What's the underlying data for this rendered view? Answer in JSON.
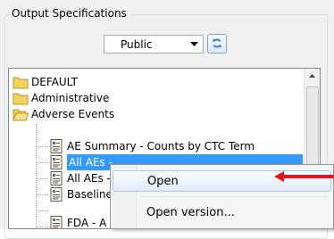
{
  "output_specifications": {
    "title": "Output Specifications",
    "visibility_select": {
      "value": "Public"
    }
  },
  "tree": {
    "items": [
      {
        "label": "DEFAULT",
        "type": "folder"
      },
      {
        "label": "Administrative",
        "type": "folder"
      },
      {
        "label": "Adverse Events",
        "type": "folder-open"
      },
      {
        "label": "AE Summary - Counts by CTC Term",
        "type": "report"
      },
      {
        "label": "All AEs - ",
        "type": "report",
        "selected": true
      },
      {
        "label": "All AEs - ",
        "type": "report"
      },
      {
        "label": "Baseline",
        "type": "report"
      },
      {
        "label": "FDA - A",
        "type": "report"
      }
    ]
  },
  "context_menu": {
    "items": [
      {
        "label": "Open",
        "highlighted": true
      },
      {
        "label": "Open version..."
      }
    ]
  },
  "colors": {
    "selection": "#3399ff",
    "annotation_arrow": "#e8131d",
    "folder": "#f2d25a"
  }
}
